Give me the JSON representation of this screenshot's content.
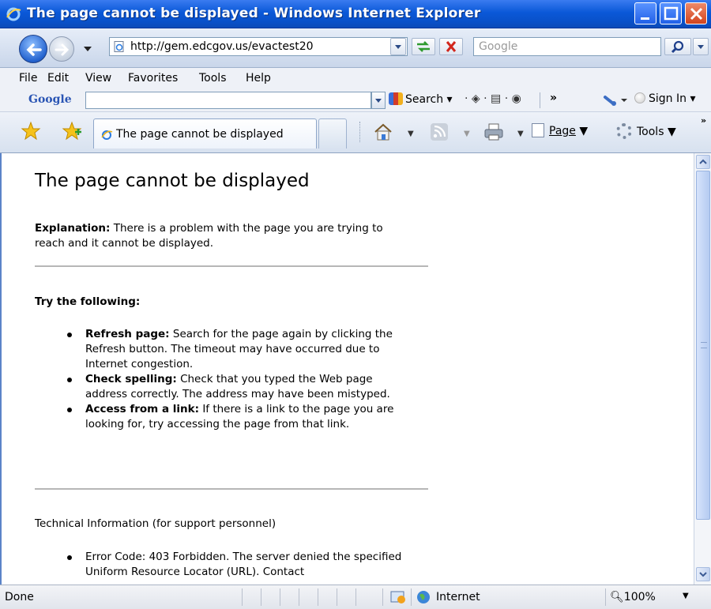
{
  "window": {
    "title": "The page cannot be displayed - Windows Internet Explorer"
  },
  "address_bar": {
    "url": "http://gem.edcgov.us/evactest20",
    "search_placeholder": "Google"
  },
  "menu": {
    "items": [
      "File",
      "Edit",
      "View",
      "Favorites",
      "Tools",
      "Help"
    ]
  },
  "google_toolbar": {
    "logo": "Google",
    "search_label": "Search",
    "more": "»",
    "sign_in": "Sign In"
  },
  "command_bar": {
    "tab_label": "The page cannot be displayed",
    "page_label": "Page",
    "tools_label": "Tools"
  },
  "content": {
    "title": "The page cannot be displayed",
    "explanation_label": "Explanation:",
    "explanation_text": "There is a problem with the page you are trying to reach and it cannot be displayed.",
    "try_heading": "Try the following:",
    "suggestions": [
      {
        "label": "Refresh page:",
        "text": "Search for the page again by clicking the Refresh button. The timeout may have occurred due to Internet congestion."
      },
      {
        "label": "Check spelling:",
        "text": "Check that you typed the Web page address correctly. The address may have been mistyped."
      },
      {
        "label": "Access from a link:",
        "text": "If there is a link to the page you are looking for, try accessing the page from that link."
      }
    ],
    "tech_heading": "Technical Information (for support personnel)",
    "tech_items": [
      "Error Code: 403 Forbidden. The server denied the specified Uniform Resource Locator (URL). Contact"
    ]
  },
  "status_bar": {
    "status": "Done",
    "zone": "Internet",
    "zoom": "100%"
  },
  "icons": {
    "back": "back-arrow-icon",
    "forward": "forward-arrow-icon",
    "refresh": "refresh-icon",
    "stop": "stop-icon",
    "search": "magnifier-icon",
    "home": "home-icon",
    "feeds": "rss-feed-icon",
    "print": "printer-icon",
    "tools": "gear-icon"
  }
}
